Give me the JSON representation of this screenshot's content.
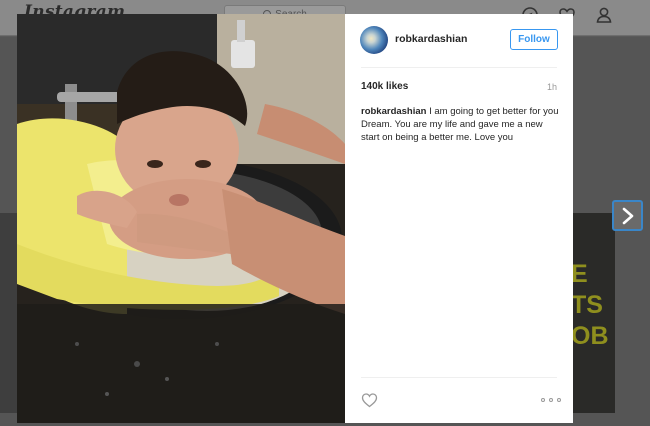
{
  "background": {
    "logo": "Instagram",
    "search_placeholder": "Search",
    "nav_icons": [
      "explore-icon",
      "activity-heart-icon",
      "profile-icon"
    ],
    "tile_right_lines": [
      "E",
      "TS",
      "OB"
    ]
  },
  "post": {
    "username": "robkardashian",
    "follow_label": "Follow",
    "likes": "140k likes",
    "time": "1h",
    "caption_user": "robkardashian",
    "caption_text": "I am going to get better for you Dream. You are my life and gave me a new start on being a better me. Love you",
    "actions": [
      "like-heart-icon",
      "more-options-icon"
    ]
  },
  "navigation": {
    "next_icon": "chevron-right-icon"
  },
  "colors": {
    "accent": "#3897f0",
    "arrow_border": "#3a86c8",
    "text": "#262626",
    "muted": "#999999"
  }
}
